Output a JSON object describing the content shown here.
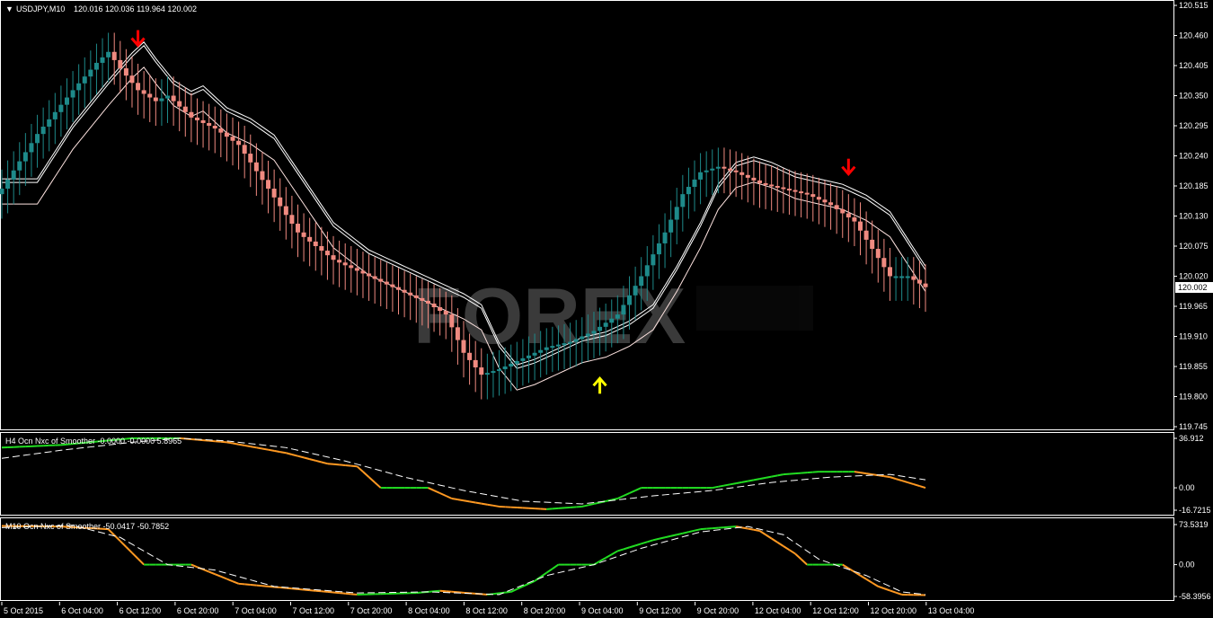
{
  "chart_data": [
    {
      "type": "candlestick",
      "panel": "main",
      "symbol_label": "USDJPY,M10",
      "ohlc_label": "120.016 120.036 119.964 120.002",
      "last_price": "120.002",
      "y_ticks": [
        "120.515",
        "120.460",
        "120.405",
        "120.350",
        "120.295",
        "120.240",
        "120.185",
        "120.130",
        "120.075",
        "120.020",
        "119.965",
        "119.910",
        "119.855",
        "119.800",
        "119.745"
      ],
      "ylim": [
        119.745,
        120.515
      ],
      "x_ticks": [
        "5 Oct 2015",
        "6 Oct 04:00",
        "6 Oct 12:00",
        "6 Oct 20:00",
        "7 Oct 04:00",
        "7 Oct 12:00",
        "7 Oct 20:00",
        "8 Oct 04:00",
        "8 Oct 12:00",
        "8 Oct 20:00",
        "9 Oct 04:00",
        "9 Oct 12:00",
        "9 Oct 20:00",
        "12 Oct 04:00",
        "12 Oct 12:00",
        "12 Oct 20:00",
        "13 Oct 04:00"
      ],
      "close_path": [
        [
          0,
          120.18
        ],
        [
          6,
          120.28
        ],
        [
          12,
          120.36
        ],
        [
          16,
          120.41
        ],
        [
          18,
          120.43
        ],
        [
          20,
          120.4
        ],
        [
          23,
          120.36
        ],
        [
          26,
          120.34
        ],
        [
          28,
          120.35
        ],
        [
          32,
          120.31
        ],
        [
          36,
          120.29
        ],
        [
          40,
          120.26
        ],
        [
          45,
          120.18
        ],
        [
          50,
          120.1
        ],
        [
          56,
          120.05
        ],
        [
          62,
          120.02
        ],
        [
          68,
          119.99
        ],
        [
          72,
          119.97
        ],
        [
          75,
          119.95
        ],
        [
          78,
          119.88
        ],
        [
          81,
          119.84
        ],
        [
          84,
          119.85
        ],
        [
          88,
          119.87
        ],
        [
          92,
          119.89
        ],
        [
          96,
          119.9
        ],
        [
          100,
          119.92
        ],
        [
          104,
          119.95
        ],
        [
          108,
          120.02
        ],
        [
          112,
          120.1
        ],
        [
          115,
          120.17
        ],
        [
          118,
          120.21
        ],
        [
          121,
          120.22
        ],
        [
          124,
          120.21
        ],
        [
          128,
          120.19
        ],
        [
          132,
          120.18
        ],
        [
          136,
          120.17
        ],
        [
          140,
          120.15
        ],
        [
          144,
          120.12
        ],
        [
          147,
          120.07
        ],
        [
          150,
          120.02
        ],
        [
          153,
          120.02
        ],
        [
          156,
          120.0
        ]
      ],
      "bar_count": 157,
      "colors": {
        "bull": "#1e8a8a",
        "bear": "#f08a80",
        "envelope_upper": "#ffffff",
        "envelope_lower": "#ffe4e1",
        "signal_down": "#ff0000",
        "signal_up": "#ffff00",
        "grid": "#ffffff"
      },
      "signals": [
        {
          "type": "down",
          "bar": 23,
          "price": 120.455
        },
        {
          "type": "up",
          "bar": 101,
          "price": 119.82
        },
        {
          "type": "down",
          "bar": 143,
          "price": 120.22
        }
      ],
      "watermark": "FOREX"
    },
    {
      "type": "line",
      "panel": "indicator-h4",
      "label": "H4 Ocn Nxc of Smoother -0.0000 -0.0000 5.8965",
      "y_ticks": [
        "36.912",
        "0.00",
        "-16.7215"
      ],
      "ylim": [
        -16.7215,
        36.912
      ],
      "series": [
        {
          "name": "main",
          "colors": {
            "up": "#22dd22",
            "down": "#ff9922"
          },
          "points": [
            [
              0,
              30
            ],
            [
              10,
              32
            ],
            [
              22,
              37
            ],
            [
              30,
              37
            ],
            [
              38,
              34
            ],
            [
              48,
              26
            ],
            [
              55,
              18
            ],
            [
              60,
              16
            ],
            [
              64,
              0
            ],
            [
              72,
              0
            ],
            [
              76,
              -8
            ],
            [
              84,
              -14
            ],
            [
              92,
              -16
            ],
            [
              98,
              -14
            ],
            [
              104,
              -8
            ],
            [
              108,
              0
            ],
            [
              120,
              0
            ],
            [
              126,
              5
            ],
            [
              132,
              10
            ],
            [
              138,
              12
            ],
            [
              144,
              12
            ],
            [
              150,
              8
            ],
            [
              156,
              0
            ]
          ]
        },
        {
          "name": "signal",
          "color": "#ffffff",
          "dashed": true,
          "points": [
            [
              0,
              22
            ],
            [
              10,
              28
            ],
            [
              22,
              34
            ],
            [
              30,
              37
            ],
            [
              38,
              35
            ],
            [
              48,
              30
            ],
            [
              58,
              20
            ],
            [
              68,
              8
            ],
            [
              78,
              -2
            ],
            [
              88,
              -10
            ],
            [
              98,
              -12
            ],
            [
              110,
              -6
            ],
            [
              120,
              -2
            ],
            [
              130,
              4
            ],
            [
              140,
              8
            ],
            [
              150,
              10
            ],
            [
              156,
              6
            ]
          ]
        }
      ]
    },
    {
      "type": "line",
      "panel": "indicator-m10",
      "label": "M10 Ocn Nxc of Smoother -50.0417 -50.7852",
      "y_ticks": [
        "73.5319",
        "0.00",
        "-58.3956"
      ],
      "ylim": [
        -58.3956,
        73.5319
      ],
      "series": [
        {
          "name": "main",
          "colors": {
            "up": "#22dd22",
            "down": "#ff9922"
          },
          "points": [
            [
              0,
              71
            ],
            [
              10,
              70
            ],
            [
              18,
              65
            ],
            [
              24,
              0
            ],
            [
              32,
              0
            ],
            [
              40,
              -35
            ],
            [
              50,
              -45
            ],
            [
              60,
              -55
            ],
            [
              70,
              -52
            ],
            [
              74,
              -48
            ],
            [
              82,
              -55
            ],
            [
              86,
              -50
            ],
            [
              90,
              -30
            ],
            [
              94,
              0
            ],
            [
              100,
              0
            ],
            [
              104,
              25
            ],
            [
              110,
              45
            ],
            [
              118,
              65
            ],
            [
              124,
              70
            ],
            [
              128,
              62
            ],
            [
              134,
              20
            ],
            [
              136,
              0
            ],
            [
              142,
              0
            ],
            [
              148,
              -40
            ],
            [
              152,
              -55
            ],
            [
              156,
              -56
            ]
          ]
        },
        {
          "name": "signal",
          "color": "#ffffff",
          "dashed": true,
          "points": [
            [
              0,
              68
            ],
            [
              12,
              72
            ],
            [
              20,
              50
            ],
            [
              28,
              0
            ],
            [
              36,
              -10
            ],
            [
              46,
              -40
            ],
            [
              60,
              -52
            ],
            [
              72,
              -50
            ],
            [
              84,
              -55
            ],
            [
              92,
              -20
            ],
            [
              100,
              0
            ],
            [
              108,
              30
            ],
            [
              118,
              60
            ],
            [
              126,
              70
            ],
            [
              132,
              55
            ],
            [
              138,
              10
            ],
            [
              146,
              -20
            ],
            [
              152,
              -50
            ],
            [
              156,
              -55
            ]
          ]
        }
      ]
    }
  ]
}
